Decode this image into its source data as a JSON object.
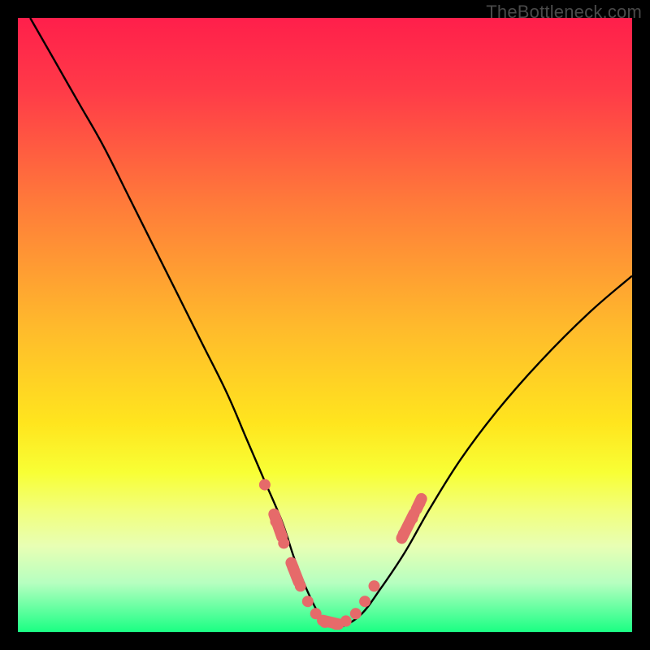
{
  "watermark": "TheBottleneck.com",
  "gradient": {
    "stops": [
      {
        "pct": 0,
        "color": "#ff1f4b"
      },
      {
        "pct": 12,
        "color": "#ff3b48"
      },
      {
        "pct": 30,
        "color": "#ff7a3a"
      },
      {
        "pct": 50,
        "color": "#ffb92c"
      },
      {
        "pct": 66,
        "color": "#ffe51e"
      },
      {
        "pct": 74,
        "color": "#f8ff35"
      },
      {
        "pct": 80,
        "color": "#f2ff7a"
      },
      {
        "pct": 86,
        "color": "#e8ffb4"
      },
      {
        "pct": 92,
        "color": "#b6ffc0"
      },
      {
        "pct": 97,
        "color": "#54ff9a"
      },
      {
        "pct": 100,
        "color": "#1aff83"
      }
    ]
  },
  "curve": {
    "stroke": "#000000",
    "stroke_width": 2.4,
    "dot_color": "#e66a6a",
    "dot_radius": 7,
    "pill_color": "#e66a6a"
  },
  "chart_data": {
    "type": "line",
    "title": "",
    "xlabel": "",
    "ylabel": "",
    "xlim": [
      0,
      100
    ],
    "ylim": [
      0,
      100
    ],
    "grid": false,
    "series": [
      {
        "name": "bottleneck-curve",
        "x": [
          2,
          6,
          10,
          14,
          18,
          22,
          26,
          30,
          34,
          37,
          40,
          43,
          45,
          47,
          49,
          51,
          53,
          56,
          59,
          63,
          67,
          72,
          78,
          85,
          93,
          100
        ],
        "y": [
          100,
          93,
          86,
          79,
          71,
          63,
          55,
          47,
          39,
          32,
          25,
          18,
          12,
          7,
          3,
          1,
          1,
          3,
          7,
          13,
          20,
          28,
          36,
          44,
          52,
          58
        ]
      }
    ],
    "annotations": {
      "dots": [
        {
          "x": 40.2,
          "y": 24
        },
        {
          "x": 42.0,
          "y": 18
        },
        {
          "x": 43.3,
          "y": 14.5
        },
        {
          "x": 44.8,
          "y": 10.5
        },
        {
          "x": 46.0,
          "y": 7.5
        },
        {
          "x": 47.2,
          "y": 5
        },
        {
          "x": 48.5,
          "y": 3
        },
        {
          "x": 50.0,
          "y": 1.6
        },
        {
          "x": 51.8,
          "y": 1.3
        },
        {
          "x": 53.4,
          "y": 1.8
        },
        {
          "x": 55.0,
          "y": 3
        },
        {
          "x": 56.5,
          "y": 5
        },
        {
          "x": 58.0,
          "y": 7.5
        },
        {
          "x": 62.8,
          "y": 16
        },
        {
          "x": 64.2,
          "y": 18.5
        },
        {
          "x": 65.4,
          "y": 21
        }
      ],
      "pills": [
        {
          "x1": 41.7,
          "y1": 19.2,
          "x2": 43.0,
          "y2": 15.5
        },
        {
          "x1": 44.5,
          "y1": 11.3,
          "x2": 45.7,
          "y2": 8.2
        },
        {
          "x1": 49.6,
          "y1": 1.9,
          "x2": 52.2,
          "y2": 1.3
        },
        {
          "x1": 62.5,
          "y1": 15.3,
          "x2": 64.5,
          "y2": 19.3
        },
        {
          "x1": 64.9,
          "y1": 20.0,
          "x2": 65.7,
          "y2": 21.7
        }
      ]
    }
  }
}
